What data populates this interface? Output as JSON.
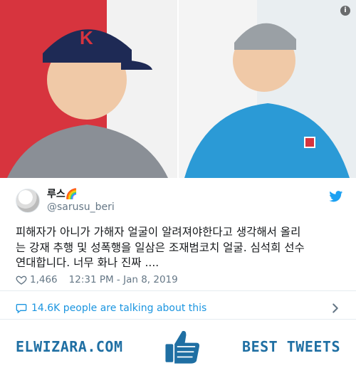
{
  "tweet": {
    "display_name": "루스🌈",
    "handle": "@sarusu_beri",
    "text": "피해자가 아니가 가해자 얼굴이 알려져야한다고 생각해서 올리\n는 강재 추행 및 성폭행을 일삼은 조재범코치 얼굴. 심석희 선수\n연대합니다. 너무 화나 진짜 ....",
    "likes": "1,466",
    "timestamp": "12:31 PM - Jan 8, 2019",
    "talking": "14.6K people are talking about this"
  },
  "footer": {
    "left_brand": "ELWIZARA.COM",
    "right_brand": "BEST TWEETS"
  },
  "icons": {
    "info": "info-icon",
    "twitter": "twitter-bird-icon",
    "heart": "heart-icon",
    "bubble": "speech-bubble-icon",
    "chevron": "chevron-right-icon",
    "thumbs": "thumbs-up-icon"
  },
  "colors": {
    "accent_blue": "#1b95e0",
    "footer_blue": "#1f6fa3",
    "muted_text": "#657786"
  }
}
